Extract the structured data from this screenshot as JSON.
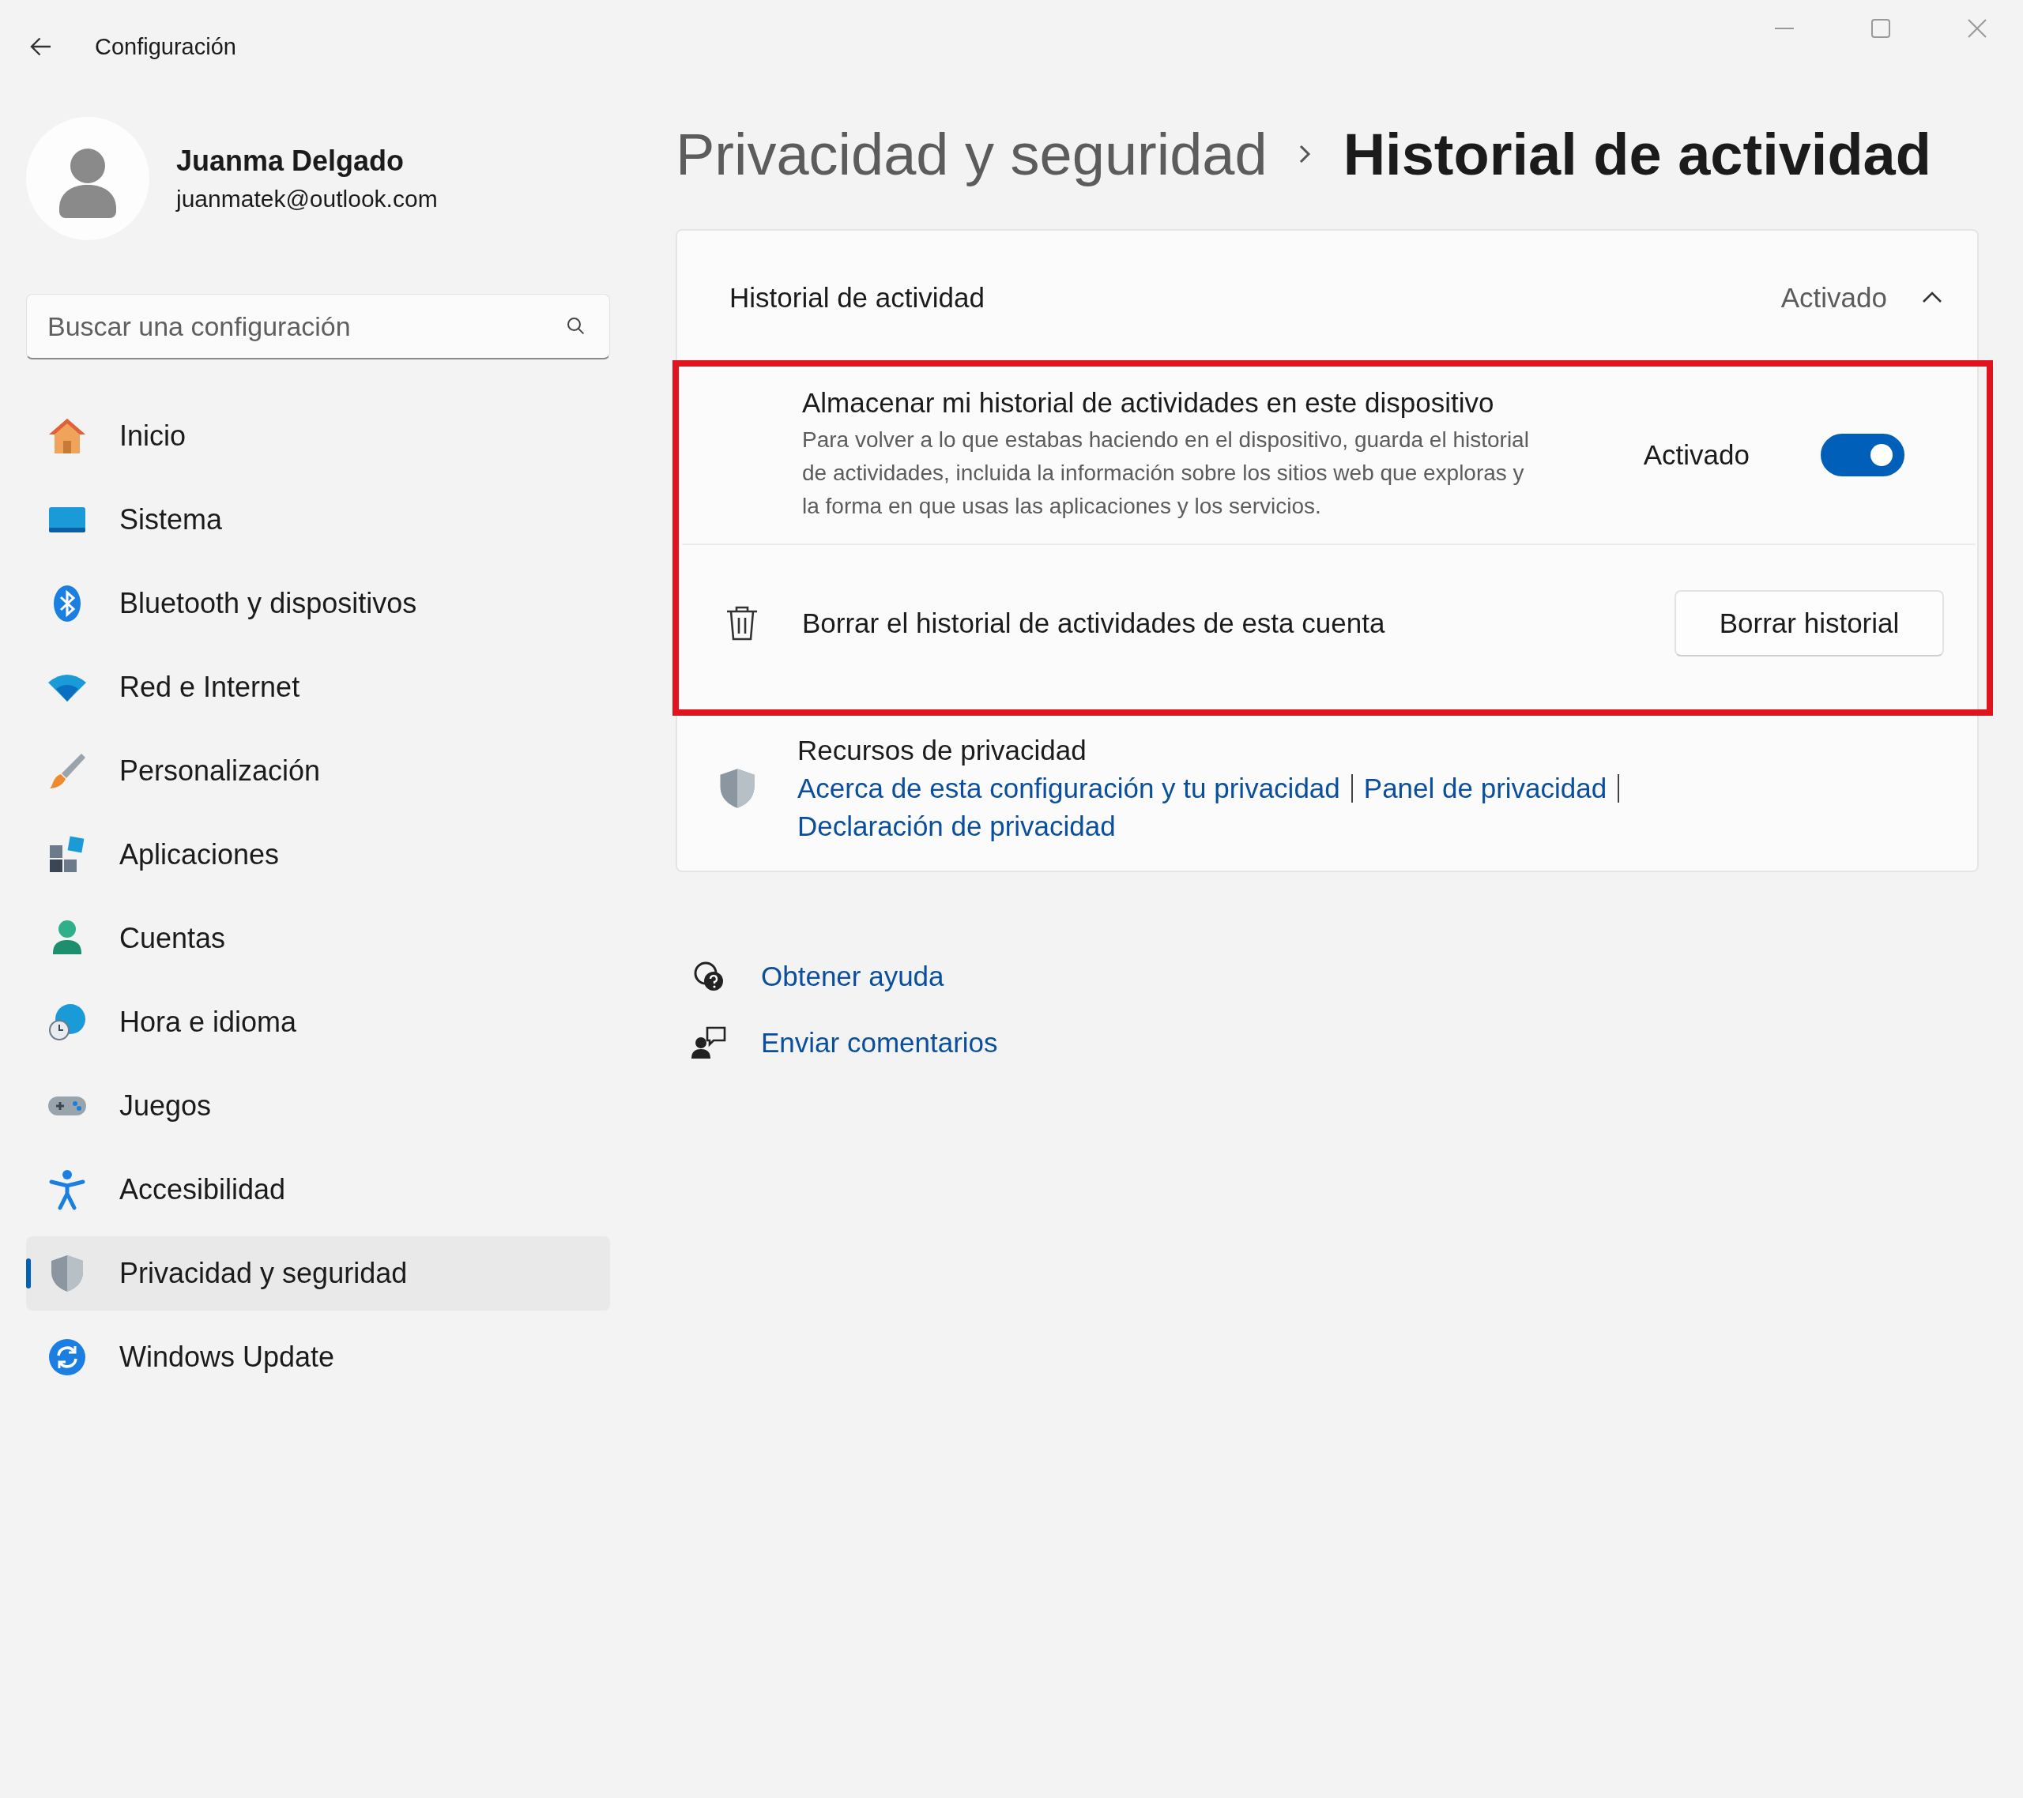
{
  "window": {
    "title": "Configuración"
  },
  "account": {
    "name": "Juanma Delgado",
    "email": "juanmatek@outlook.com"
  },
  "search": {
    "placeholder": "Buscar una configuración"
  },
  "sidebar": {
    "items": [
      {
        "label": "Inicio",
        "selected": false
      },
      {
        "label": "Sistema",
        "selected": false
      },
      {
        "label": "Bluetooth y dispositivos",
        "selected": false
      },
      {
        "label": "Red e Internet",
        "selected": false
      },
      {
        "label": "Personalización",
        "selected": false
      },
      {
        "label": "Aplicaciones",
        "selected": false
      },
      {
        "label": "Cuentas",
        "selected": false
      },
      {
        "label": "Hora e idioma",
        "selected": false
      },
      {
        "label": "Juegos",
        "selected": false
      },
      {
        "label": "Accesibilidad",
        "selected": false
      },
      {
        "label": "Privacidad y seguridad",
        "selected": true
      },
      {
        "label": "Windows Update",
        "selected": false
      }
    ]
  },
  "breadcrumb": [
    "Privacidad y seguridad",
    "Historial de actividad"
  ],
  "section": {
    "title": "Historial de actividad",
    "status": "Activado",
    "expanded": true,
    "highlighted": true,
    "settings": [
      {
        "kind": "toggle",
        "title": "Almacenar mi historial de actividades en este dispositivo",
        "description": "Para volver a lo que estabas haciendo en el dispositivo, guarda el historial de actividades, incluida la información sobre los sitios web que exploras y la forma en que usas las aplicaciones y los servicios.",
        "status": "Activado",
        "on": true
      },
      {
        "kind": "button",
        "title": "Borrar el historial de actividades de esta cuenta",
        "button": "Borrar historial"
      }
    ]
  },
  "resources": {
    "title": "Recursos de privacidad",
    "links": [
      "Acerca de esta configuración y tu privacidad",
      "Panel de privacidad",
      "Declaración de privacidad"
    ]
  },
  "help_links": [
    "Obtener ayuda",
    "Enviar comentarios"
  ]
}
